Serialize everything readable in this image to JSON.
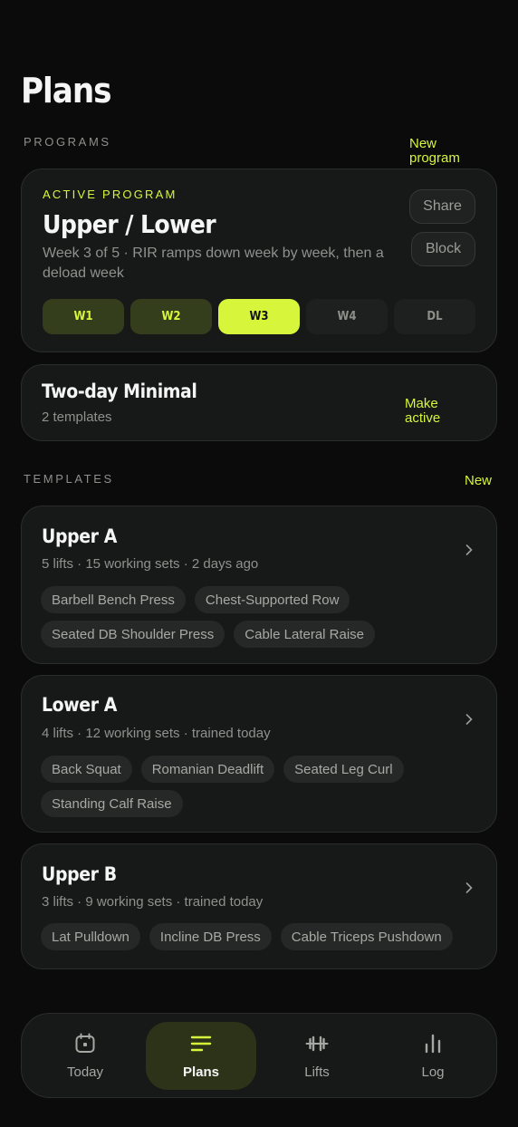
{
  "page": {
    "title": "Plans"
  },
  "programs": {
    "section_label": "PROGRAMS",
    "new_label": "New\nprogram",
    "active": {
      "eyebrow": "ACTIVE PROGRAM",
      "name": "Upper / Lower",
      "description": "Week 3 of 5 · RIR ramps down week by week, then a deload week",
      "share_label": "Share",
      "block_label": "Block",
      "weeks": [
        {
          "label": "W1",
          "state": "done"
        },
        {
          "label": "W2",
          "state": "done"
        },
        {
          "label": "W3",
          "state": "current"
        },
        {
          "label": "W4",
          "state": "future"
        },
        {
          "label": "DL",
          "state": "future"
        }
      ]
    },
    "other": {
      "name": "Two-day Minimal",
      "meta": "2 templates",
      "make_active_label": "Make\nactive"
    }
  },
  "templates": {
    "section_label": "TEMPLATES",
    "new_label": "New",
    "items": [
      {
        "name": "Upper A",
        "meta": "5 lifts · 15 working sets · 2 days ago",
        "lifts": [
          "Barbell Bench Press",
          "Chest-Supported Row",
          "Seated DB Shoulder Press",
          "Cable Lateral Raise"
        ]
      },
      {
        "name": "Lower A",
        "meta": "4 lifts · 12 working sets · trained today",
        "lifts": [
          "Back Squat",
          "Romanian Deadlift",
          "Seated Leg Curl",
          "Standing Calf Raise"
        ]
      },
      {
        "name": "Upper B",
        "meta": "3 lifts · 9 working sets · trained today",
        "lifts": [
          "Lat Pulldown",
          "Incline DB Press",
          "Cable Triceps Pushdown"
        ]
      }
    ]
  },
  "tabbar": {
    "tabs": [
      {
        "label": "Today",
        "icon": "calendar-icon",
        "active": false
      },
      {
        "label": "Plans",
        "icon": "list-icon",
        "active": true
      },
      {
        "label": "Lifts",
        "icon": "dumbbell-icon",
        "active": false
      },
      {
        "label": "Log",
        "icon": "bar-chart-icon",
        "active": false
      }
    ]
  },
  "colors": {
    "accent": "#d7f53b",
    "background": "#0b0b0b",
    "card": "#171918",
    "muted_text": "#8e918d"
  }
}
